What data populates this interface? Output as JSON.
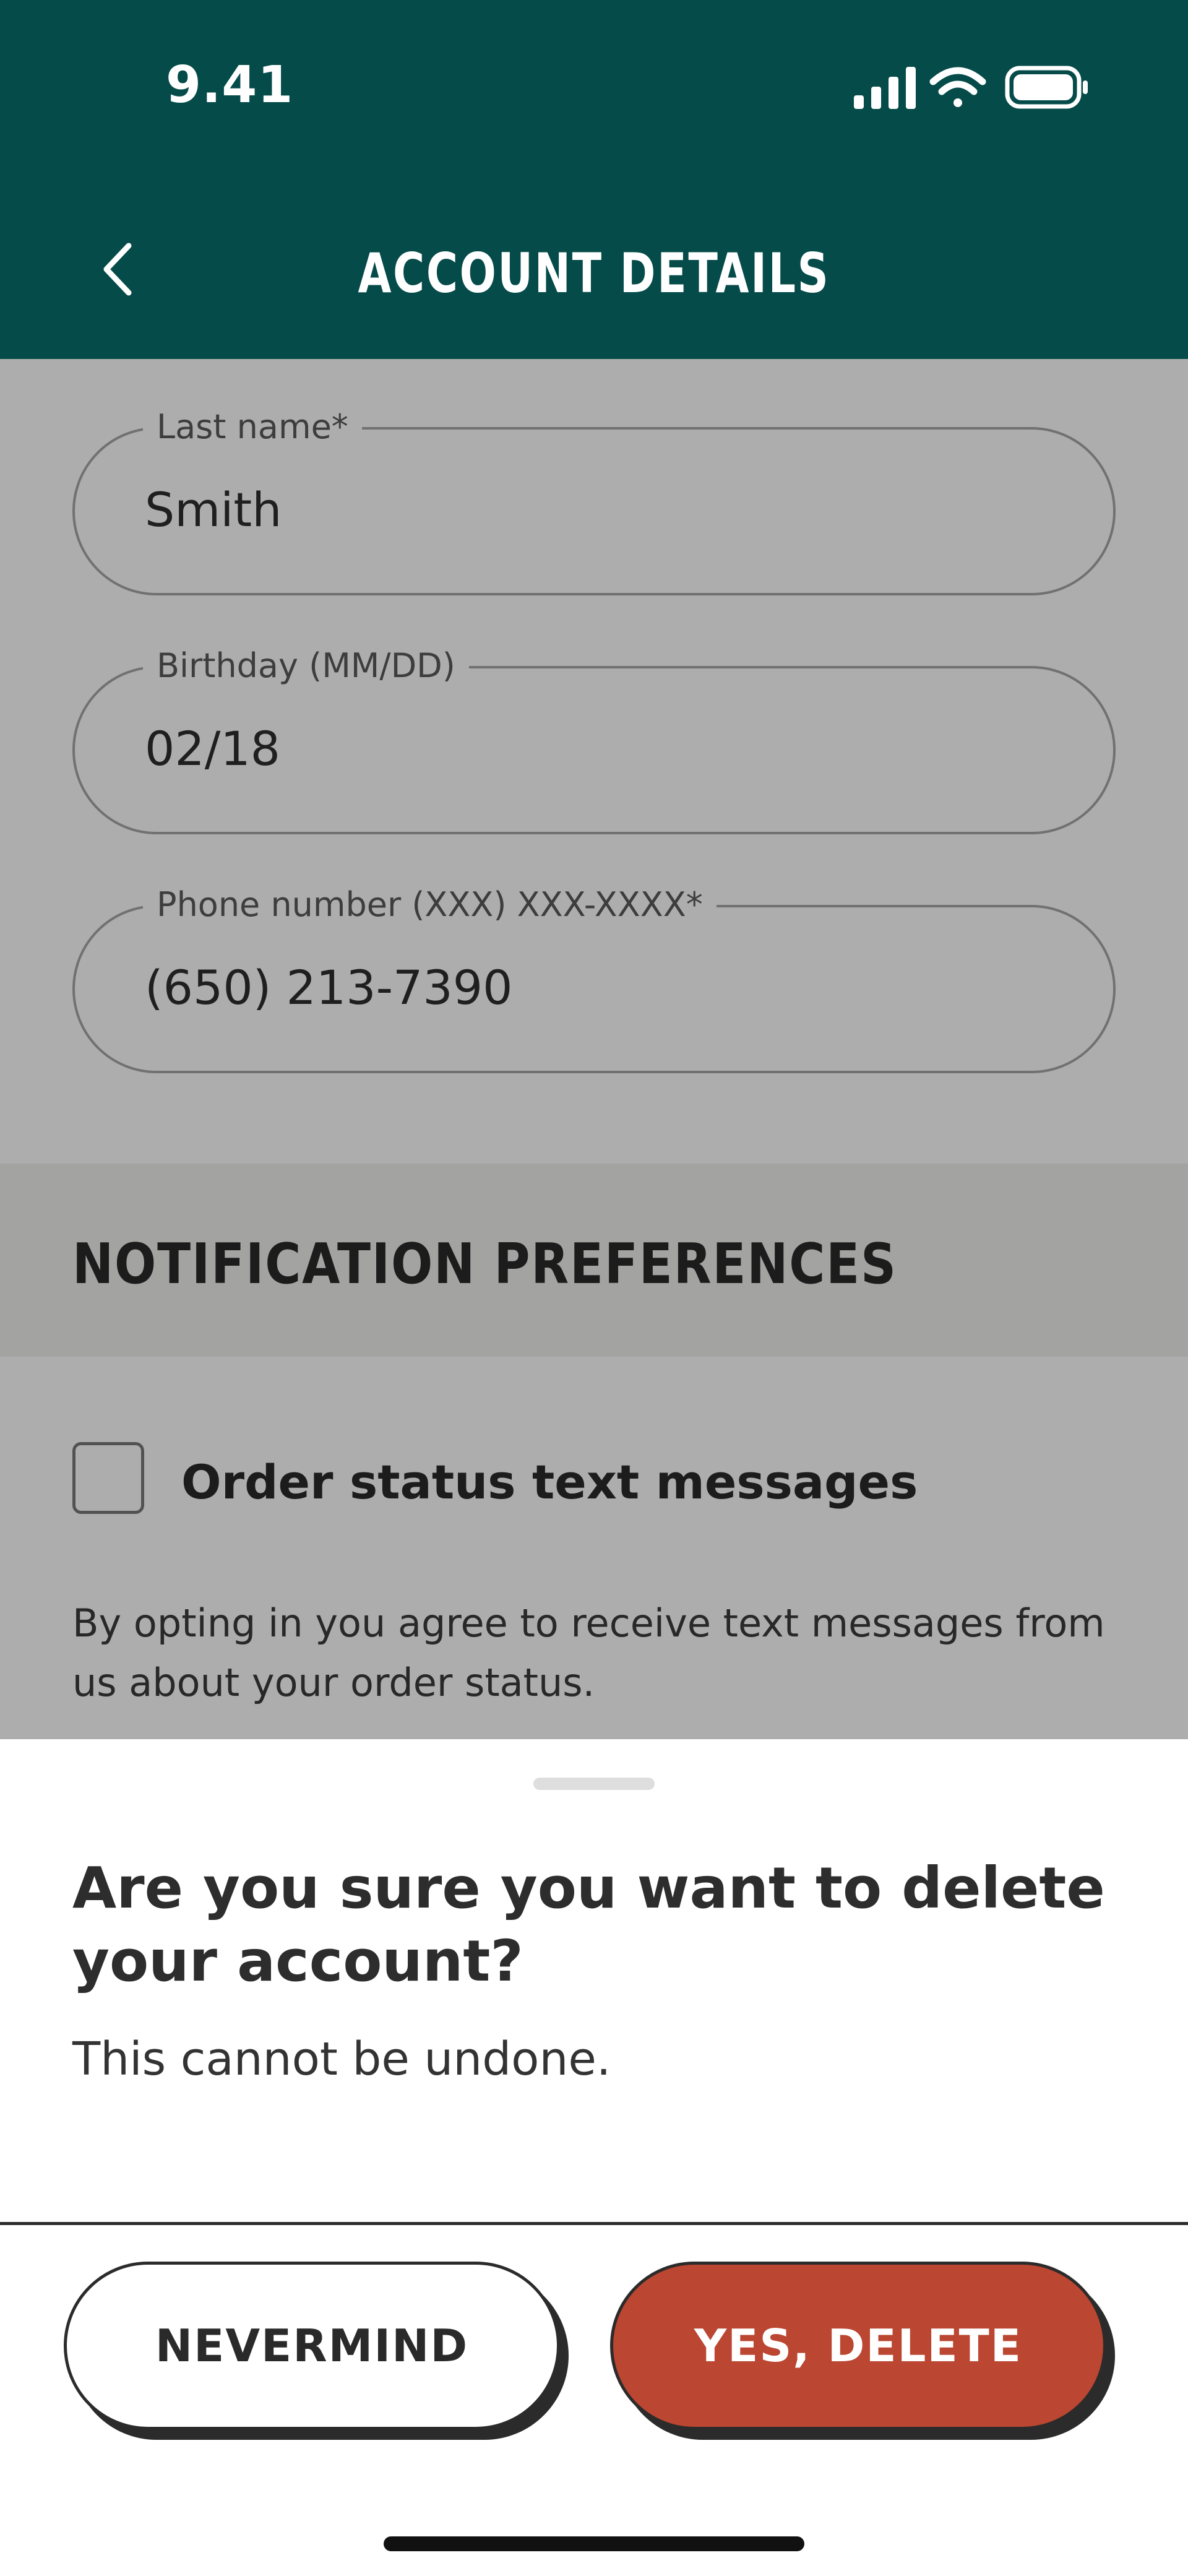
{
  "status_bar": {
    "time": "9.41",
    "icons": [
      "cellular-signal-icon",
      "wifi-icon",
      "battery-icon"
    ]
  },
  "header": {
    "back_icon": "chevron-left-icon",
    "title": "ACCOUNT DETAILS"
  },
  "form": {
    "last_name": {
      "label": "Last name*",
      "value": "Smith"
    },
    "birthday": {
      "label": "Birthday (MM/DD)",
      "value": "02/18"
    },
    "phone": {
      "label": "Phone number (XXX) XXX-XXXX*",
      "value": "(650) 213-7390"
    }
  },
  "notifications": {
    "section_title": "NOTIFICATION PREFERENCES",
    "order_status": {
      "label": "Order status text messages",
      "checked": false
    },
    "consent_text": "By opting in you agree to receive text messages from us about your order status."
  },
  "dialog": {
    "title": "Are you sure you want to delete your account?",
    "message": "This cannot be undone.",
    "cancel_label": "NEVERMIND",
    "confirm_label": "YES, DELETE"
  },
  "colors": {
    "header_bg": "#054b49",
    "delete_button": "#bb4631",
    "scrim": "rgba(0,0,0,0.32)"
  }
}
